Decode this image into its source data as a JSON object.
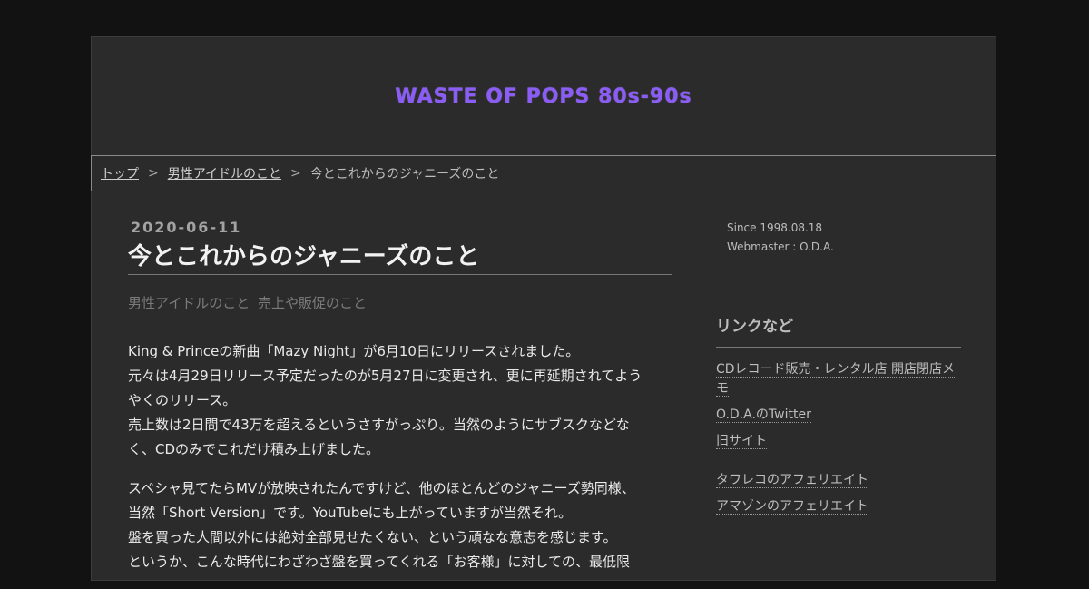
{
  "site": {
    "title": "WASTE OF POPS 80s-90s"
  },
  "breadcrumb": {
    "top": "トップ",
    "category": "男性アイドルのこと",
    "current": "今とこれからのジャニーズのこと",
    "separator": ">"
  },
  "entry": {
    "date": "2020-06-11",
    "title": "今とこれからのジャニーズのこと",
    "categories": [
      "男性アイドルのこと",
      "売上や販促のこと"
    ],
    "paragraphs": [
      [
        "King & Princeの新曲「Mazy Night」が6月10日にリリースされました。",
        "元々は4月29日リリース予定だったのが5月27日に変更され、更に再延期されてよう",
        "やくのリリース。",
        "売上数は2日間で43万を超えるというさすがっぷり。当然のようにサブスクなどな",
        "く、CDのみでこれだけ積み上げました。"
      ],
      [
        "スペシャ見てたらMVが放映されたんですけど、他のほとんどのジャニーズ勢同様、",
        "当然「Short Version」です。YouTubeにも上がっていますが当然それ。",
        "盤を買った人間以外には絶対全部見せたくない、という頑なな意志を感じます。",
        "というか、こんな時代にわざわざ盤を買ってくれる「お客様」に対しての、最低限"
      ]
    ]
  },
  "sidebar": {
    "since": "Since 1998.08.18",
    "webmaster": "Webmaster : O.D.A.",
    "heading": "リンクなど",
    "links": [
      "CDレコード販売・レンタル店 開店閉店メモ",
      "O.D.A.のTwitter",
      "旧サイト",
      "タワレコのアフェリエイト",
      "アマゾンのアフェリエイト"
    ]
  },
  "colors": {
    "title_accent": "#8b5cf6",
    "page_bg": "#2b2b2b",
    "outer_bg": "#121212"
  }
}
